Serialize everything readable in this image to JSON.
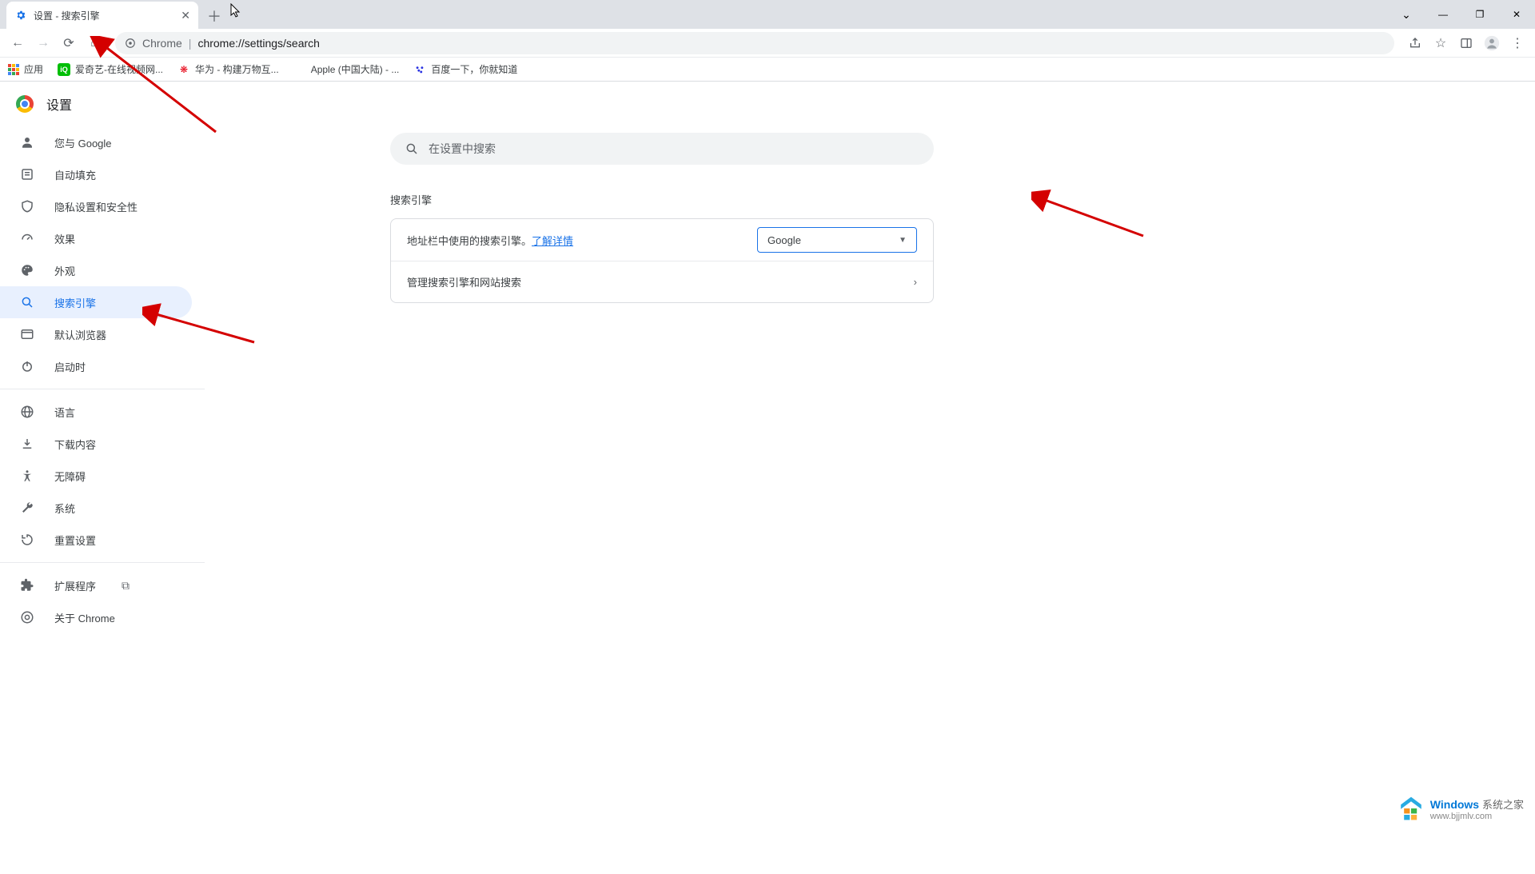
{
  "tab": {
    "title": "设置 - 搜索引擎"
  },
  "omnibox": {
    "prefix": "Chrome",
    "url": "chrome://settings/search"
  },
  "bookmarks": {
    "apps": "应用",
    "items": [
      {
        "label": "爱奇艺-在线视频网..."
      },
      {
        "label": "华为 - 构建万物互..."
      },
      {
        "label": "Apple (中国大陆) - ..."
      },
      {
        "label": "百度一下，你就知道"
      }
    ]
  },
  "settings": {
    "title": "设置",
    "nav": [
      {
        "label": "您与 Google"
      },
      {
        "label": "自动填充"
      },
      {
        "label": "隐私设置和安全性"
      },
      {
        "label": "效果"
      },
      {
        "label": "外观"
      },
      {
        "label": "搜索引擎"
      },
      {
        "label": "默认浏览器"
      },
      {
        "label": "启动时"
      }
    ],
    "nav2": [
      {
        "label": "语言"
      },
      {
        "label": "下载内容"
      },
      {
        "label": "无障碍"
      },
      {
        "label": "系统"
      },
      {
        "label": "重置设置"
      }
    ],
    "nav3": [
      {
        "label": "扩展程序"
      },
      {
        "label": "关于 Chrome"
      }
    ],
    "search_placeholder": "在设置中搜索",
    "section_title": "搜索引擎",
    "row1_text": "地址栏中使用的搜索引擎。",
    "row1_link": "了解详情",
    "row1_select": "Google",
    "row2_text": "管理搜索引擎和网站搜索"
  },
  "watermark": {
    "line1a": "Windows",
    "line1b": "系统之家",
    "line2": "www.bjjmlv.com"
  }
}
